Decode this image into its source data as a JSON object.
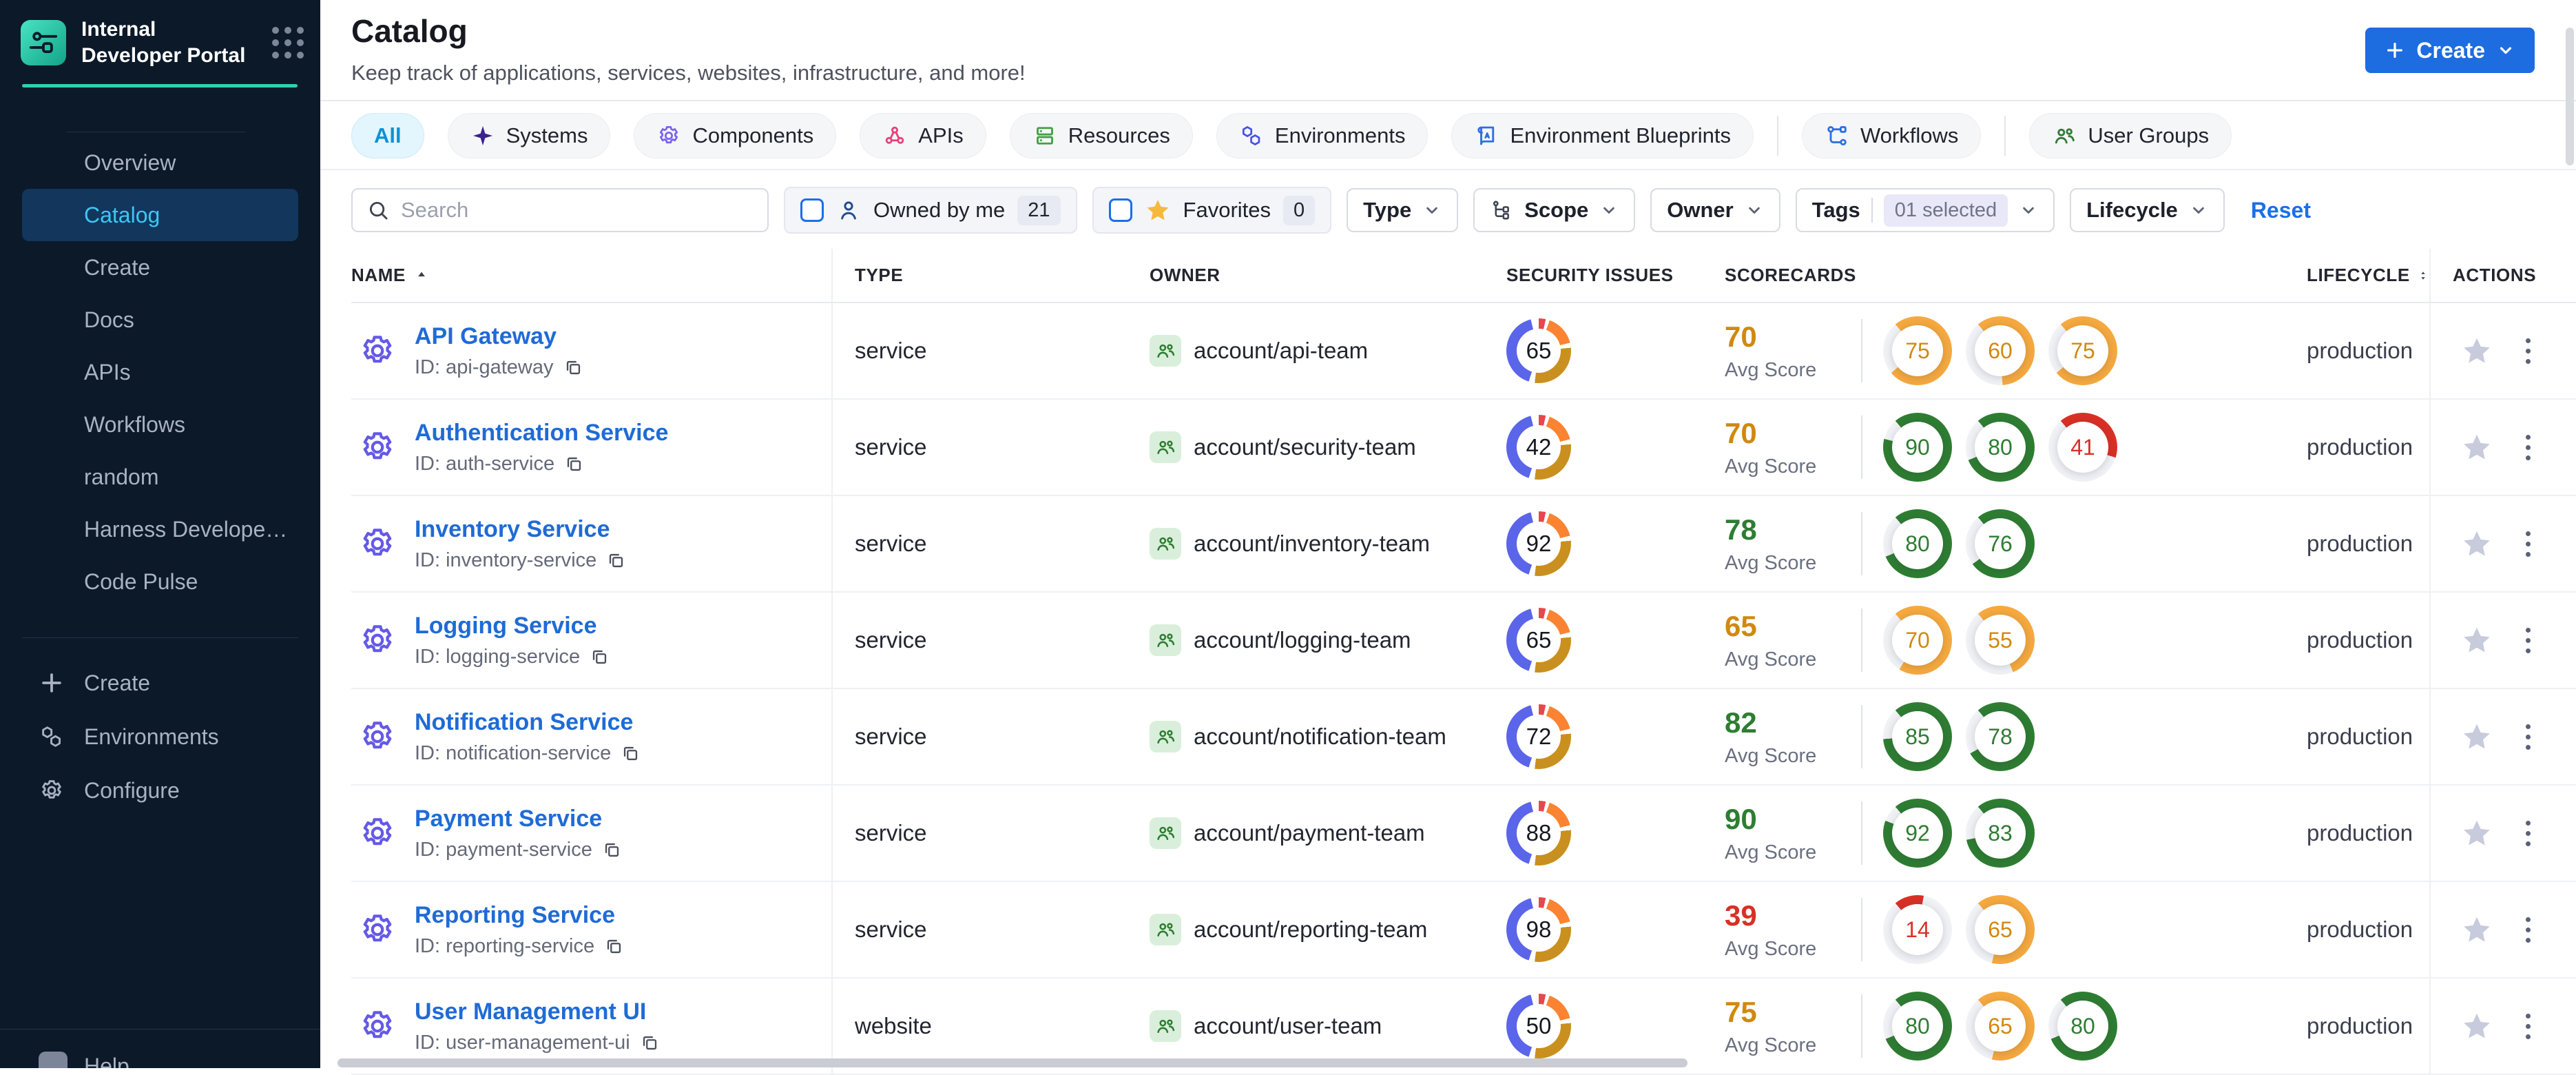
{
  "app": {
    "title": "Internal Developer Portal",
    "help_label": "Help"
  },
  "sidebar": {
    "nav": [
      {
        "label": "Overview",
        "active": false
      },
      {
        "label": "Catalog",
        "active": true
      },
      {
        "label": "Create",
        "active": false
      },
      {
        "label": "Docs",
        "active": false
      },
      {
        "label": "APIs",
        "active": false
      },
      {
        "label": "Workflows",
        "active": false
      },
      {
        "label": "random",
        "active": false
      },
      {
        "label": "Harness Develope…",
        "active": false
      },
      {
        "label": "Code Pulse",
        "active": false
      }
    ],
    "tools": [
      {
        "icon": "plus",
        "label": "Create"
      },
      {
        "icon": "hexagons",
        "label": "Environments"
      },
      {
        "icon": "gear",
        "label": "Configure"
      }
    ]
  },
  "header": {
    "title": "Catalog",
    "subtitle": "Keep track of applications, services, websites, infrastructure, and more!",
    "create_label": "Create"
  },
  "tabs": [
    {
      "label": "All",
      "icon": "",
      "icon_color": "",
      "active": true,
      "divider_after": false
    },
    {
      "label": "Systems",
      "icon": "systems",
      "icon_color": "#3b2191",
      "active": false,
      "divider_after": false
    },
    {
      "label": "Components",
      "icon": "gear",
      "icon_color": "#7b61f0",
      "active": false,
      "divider_after": false
    },
    {
      "label": "APIs",
      "icon": "api",
      "icon_color": "#e8417d",
      "active": false,
      "divider_after": false
    },
    {
      "label": "Resources",
      "icon": "server",
      "icon_color": "#43a047",
      "active": false,
      "divider_after": false
    },
    {
      "label": "Environments",
      "icon": "hexagons",
      "icon_color": "#4553e8",
      "active": false,
      "divider_after": false
    },
    {
      "label": "Environment Blueprints",
      "icon": "blueprint",
      "icon_color": "#2c6fe3",
      "active": false,
      "divider_after": true
    },
    {
      "label": "Workflows",
      "icon": "workflow",
      "icon_color": "#2c6fe3",
      "active": false,
      "divider_after": true
    },
    {
      "label": "User Groups",
      "icon": "users",
      "icon_color": "#357a38",
      "active": false,
      "divider_after": false
    }
  ],
  "filters": {
    "search_placeholder": "Search",
    "owned_by_me": {
      "label": "Owned by me",
      "count": "21"
    },
    "favorites": {
      "label": "Favorites",
      "count": "0"
    },
    "type_label": "Type",
    "scope_label": "Scope",
    "owner_label": "Owner",
    "tags": {
      "label": "Tags",
      "value": "01 selected"
    },
    "lifecycle_label": "Lifecycle",
    "reset_label": "Reset"
  },
  "table": {
    "columns": {
      "name": "NAME",
      "type": "TYPE",
      "owner": "OWNER",
      "security": "SECURITY ISSUES",
      "scorecards": "SCORECARDS",
      "lifecycle": "LIFECYCLE",
      "actions": "ACTIONS"
    },
    "id_prefix": "ID: ",
    "avg_score_label": "Avg Score",
    "rows": [
      {
        "name": "API Gateway",
        "id": "api-gateway",
        "type": "service",
        "owner": "account/api-team",
        "security_issues": 65,
        "avg_score": 70,
        "scores": [
          75,
          60,
          75
        ],
        "lifecycle": "production"
      },
      {
        "name": "Authentication Service",
        "id": "auth-service",
        "type": "service",
        "owner": "account/security-team",
        "security_issues": 42,
        "avg_score": 70,
        "scores": [
          90,
          80,
          41
        ],
        "lifecycle": "production"
      },
      {
        "name": "Inventory Service",
        "id": "inventory-service",
        "type": "service",
        "owner": "account/inventory-team",
        "security_issues": 92,
        "avg_score": 78,
        "scores": [
          80,
          76
        ],
        "lifecycle": "production"
      },
      {
        "name": "Logging Service",
        "id": "logging-service",
        "type": "service",
        "owner": "account/logging-team",
        "security_issues": 65,
        "avg_score": 65,
        "scores": [
          70,
          55
        ],
        "lifecycle": "production"
      },
      {
        "name": "Notification Service",
        "id": "notification-service",
        "type": "service",
        "owner": "account/notification-team",
        "security_issues": 72,
        "avg_score": 82,
        "scores": [
          85,
          78
        ],
        "lifecycle": "production"
      },
      {
        "name": "Payment Service",
        "id": "payment-service",
        "type": "service",
        "owner": "account/payment-team",
        "security_issues": 88,
        "avg_score": 90,
        "scores": [
          92,
          83
        ],
        "lifecycle": "production"
      },
      {
        "name": "Reporting Service",
        "id": "reporting-service",
        "type": "service",
        "owner": "account/reporting-team",
        "security_issues": 98,
        "avg_score": 39,
        "scores": [
          14,
          65
        ],
        "lifecycle": "production"
      },
      {
        "name": "User Management UI",
        "id": "user-management-ui",
        "type": "website",
        "owner": "account/user-team",
        "security_issues": 50,
        "avg_score": 75,
        "scores": [
          80,
          65,
          80
        ],
        "lifecycle": "production"
      }
    ]
  },
  "colors": {
    "accent_blue": "#1d6ce0",
    "teal": "#2fd0ad",
    "ring_green": "#2e7d32",
    "ring_orange": "#f5a93f",
    "ring_red": "#d93025",
    "text_green": "#2e7d32",
    "text_orange": "#d0890f",
    "text_red": "#d93025",
    "owner_green": "#2e7d32"
  }
}
